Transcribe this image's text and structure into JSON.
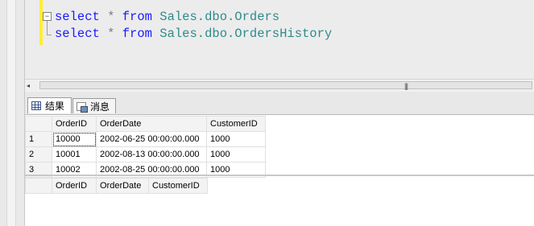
{
  "editor": {
    "lines": [
      {
        "kw1": "select",
        "op": "*",
        "kw2": "from",
        "obj": "Sales.dbo.Orders"
      },
      {
        "kw1": "select",
        "op": "*",
        "kw2": "from",
        "obj": "Sales.dbo.OrdersHistory"
      }
    ],
    "fold_symbol": "−",
    "colors": {
      "keyword": "#1a1aff",
      "object": "#2e8b8b",
      "operator": "#7a7a7a",
      "change_bar": "#ffee33"
    }
  },
  "scrollbar": {
    "left_arrow": "◂",
    "grip": "|||"
  },
  "tabs": [
    {
      "label": "结果",
      "icon": "grid-icon",
      "active": true
    },
    {
      "label": "消息",
      "icon": "message-icon",
      "active": false
    }
  ],
  "result_sets": [
    {
      "columns": [
        "OrderID",
        "OrderDate",
        "CustomerID"
      ],
      "rows": [
        {
          "num": "1",
          "cells": [
            "10000",
            "2002-06-25 00:00:00.000",
            "1000"
          ]
        },
        {
          "num": "2",
          "cells": [
            "10001",
            "2002-08-13 00:00:00.000",
            "1000"
          ]
        },
        {
          "num": "3",
          "cells": [
            "10002",
            "2002-08-25 00:00:00.000",
            "1000"
          ]
        }
      ]
    },
    {
      "columns": [
        "OrderID",
        "OrderDate",
        "CustomerID"
      ],
      "rows": []
    }
  ]
}
